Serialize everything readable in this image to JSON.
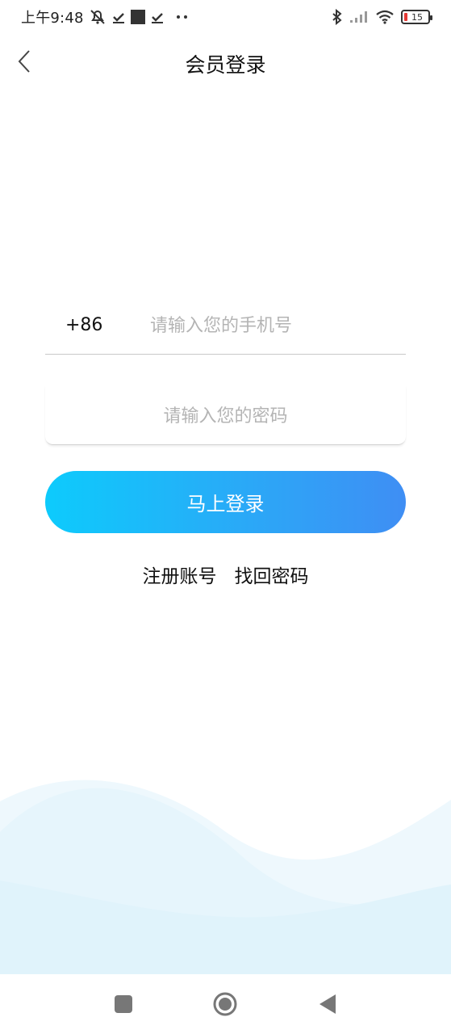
{
  "status_bar": {
    "time": "上午9:48",
    "battery_level": "15"
  },
  "header": {
    "title": "会员登录"
  },
  "login_form": {
    "country_code": "+86",
    "phone_placeholder": "请输入您的手机号",
    "password_placeholder": "请输入您的密码",
    "submit_label": "马上登录"
  },
  "links": {
    "register": "注册账号",
    "recover_password": "找回密码"
  },
  "colors": {
    "button_gradient_start": "#0dcbfc",
    "button_gradient_end": "#3f8ef4",
    "wave_light": "#eaf7fd",
    "wave_dark": "#def3fb"
  },
  "icons": {
    "back": "back-chevron-icon",
    "nav_recent": "square-icon",
    "nav_home": "circle-icon",
    "nav_back": "triangle-back-icon"
  }
}
